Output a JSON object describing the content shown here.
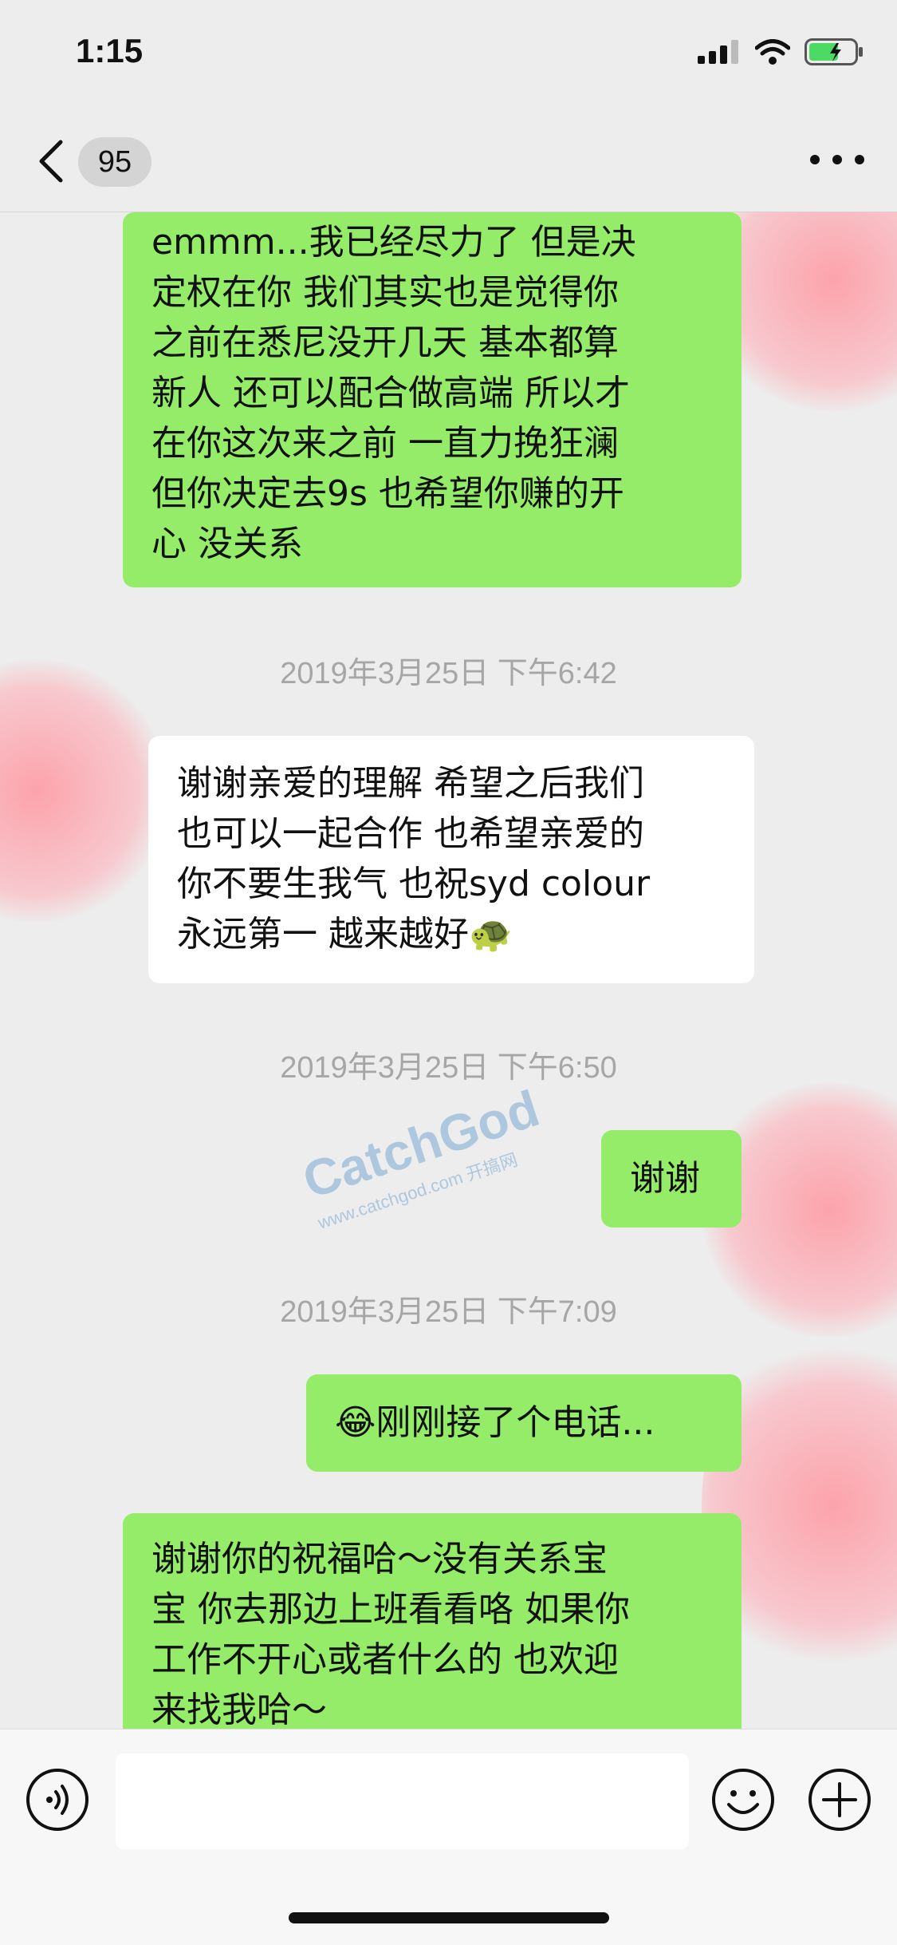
{
  "status_bar": {
    "time": "1:15"
  },
  "nav": {
    "unread_count": "95"
  },
  "messages": [
    {
      "side": "right",
      "type": "green",
      "text": "emmm...我已经尽力了 但是决\n定权在你 我们其实也是觉得你\n之前在悉尼没开几天 基本都算\n新人 还可以配合做高端 所以才\n在你这次来之前 一直力挽狂澜\n但你决定去9s 也希望你赚的开\n心 没关系"
    },
    {
      "timestamp": "2019年3月25日 下午6:42"
    },
    {
      "side": "left",
      "type": "white",
      "text": "谢谢亲爱的理解 希望之后我们\n也可以一起合作 也希望亲爱的\n你不要生我气 也祝syd colour\n永远第一 越来越好🐢"
    },
    {
      "timestamp": "2019年3月25日 下午6:50"
    },
    {
      "side": "right",
      "type": "green",
      "text": "谢谢"
    },
    {
      "timestamp": "2019年3月25日 下午7:09"
    },
    {
      "side": "right",
      "type": "green",
      "text": "😂刚刚接了个电话..."
    },
    {
      "side": "right",
      "type": "green",
      "text": "谢谢你的祝福哈～没有关系宝\n宝 你去那边上班看看咯 如果你\n工作不开心或者什么的 也欢迎\n来找我哈～"
    }
  ],
  "stickers": [
    "love",
    "heart",
    "diamond",
    "love",
    "love"
  ],
  "watermark": {
    "brand": "CatchGod",
    "url": "www.catchgod.com 开搞网"
  },
  "icons": {
    "back": "chevron-left-icon",
    "more": "more-dots-icon",
    "voice": "voice-icon",
    "emoji": "emoji-icon",
    "plus": "plus-icon"
  },
  "colors": {
    "bubble_green": "#95ec69",
    "bubble_white": "#ffffff",
    "background": "#ededed"
  }
}
